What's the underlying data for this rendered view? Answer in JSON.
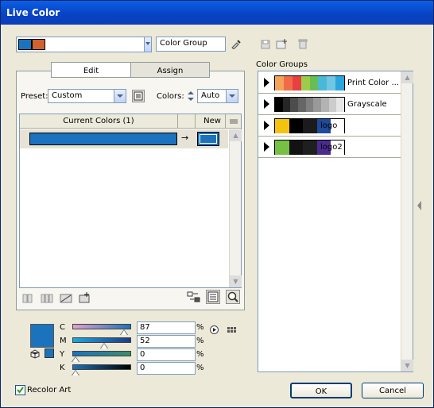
{
  "window": {
    "title": "Live Color"
  },
  "top": {
    "group_swatch_colors": [
      "#1b73bd",
      "#d0622d"
    ],
    "group_name": "Color Group",
    "group_name_icon": "eyedropper-icon"
  },
  "top_icons": [
    "save-icon",
    "new-group-icon",
    "delete-icon"
  ],
  "tabs": [
    {
      "label": "Edit",
      "active": true
    },
    {
      "label": "Assign",
      "active": false
    }
  ],
  "preset": {
    "label": "Preset:",
    "value": "Custom"
  },
  "colors": {
    "label": "Colors:",
    "value": "Auto"
  },
  "color_table": {
    "header_current": "Current Colors (1)",
    "header_new": "New",
    "rows": [
      {
        "current": "#1b73bd",
        "new": "#1b73bd"
      }
    ]
  },
  "color_groups": {
    "label": "Color Groups",
    "items": [
      {
        "name": "Print Color ...",
        "chips": [
          "#f4a35a",
          "#f06b48",
          "#e84040",
          "#9ccd4a",
          "#68be53",
          "#48b9d6",
          "#71c6e4",
          "#2ba6df"
        ]
      },
      {
        "name": "Grayscale",
        "chips": [
          "#000000",
          "#262626",
          "#4d4d4d",
          "#666666",
          "#808080",
          "#999999",
          "#b3b3b3",
          "#cccccc",
          "#e6e6e6"
        ]
      },
      {
        "name": "logo",
        "chips": [
          "#f4c30f",
          "#000000",
          "#1b1b1b",
          "#1e4a9a"
        ]
      },
      {
        "name": "logo2",
        "chips": [
          "#76c043",
          "#121212",
          "#1f1f1f",
          "#4a2c8f"
        ]
      }
    ]
  },
  "cmyk": {
    "preview_color": "#1b73bd",
    "rows": [
      {
        "label": "C",
        "value": "87",
        "unit": "%",
        "level": 0.87
      },
      {
        "label": "M",
        "value": "52",
        "unit": "%",
        "level": 0.52
      },
      {
        "label": "Y",
        "value": "0",
        "unit": "%",
        "level": 0.0
      },
      {
        "label": "K",
        "value": "0",
        "unit": "%",
        "level": 0.0
      }
    ]
  },
  "footer": {
    "recolor_label": "Recolor Art",
    "recolor_checked": true,
    "ok_label": "OK",
    "cancel_label": "Cancel"
  }
}
